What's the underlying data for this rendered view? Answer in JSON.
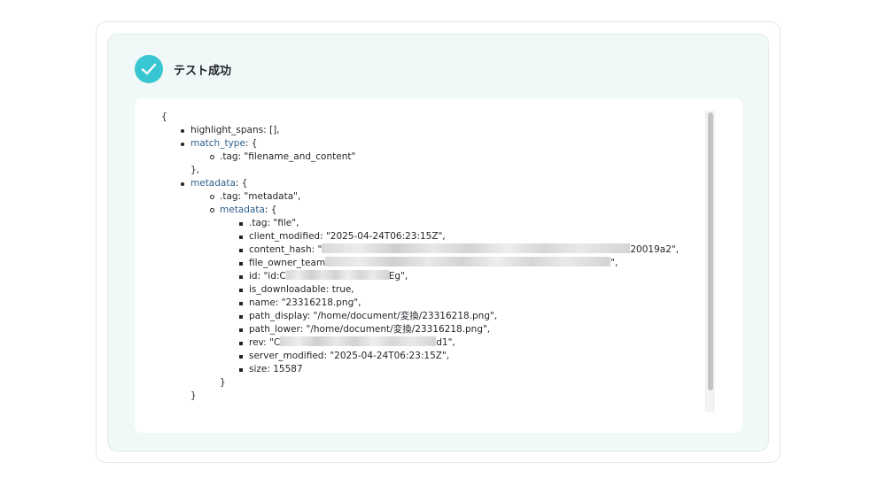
{
  "header": {
    "title": "テスト成功",
    "icon": "check-circle-icon",
    "accent_color": "#38c7d2"
  },
  "json": {
    "open_brace": "{",
    "highlight_spans": "highlight_spans: [],",
    "match_type_key": "match_type",
    "match_type_open": ": {",
    "match_type_tag": ".tag: \"filename_and_content\"",
    "match_type_close": "},",
    "metadata_key": "metadata",
    "metadata_open": ": {",
    "metadata_tag": ".tag: \"metadata\",",
    "inner_metadata_key": "metadata",
    "inner_metadata_open": ": {",
    "fields": {
      "tag": ".tag: \"file\",",
      "client_modified": "client_modified: \"2025-04-24T06:23:15Z\",",
      "content_hash_prefix": "content_hash: \"",
      "content_hash_suffix": "20019a2\",",
      "file_owner_team_prefix": "file_owner_team",
      "file_owner_team_suffix": "\",",
      "id_prefix": "id: \"id:C",
      "id_suffix": "Eg\",",
      "is_downloadable": "is_downloadable: true,",
      "name": "name: \"23316218.png\",",
      "path_display": "path_display: \"/home/document/変換/23316218.png\",",
      "path_lower": "path_lower: \"/home/document/変換/23316218.png\",",
      "rev_prefix": "rev: \"C",
      "rev_suffix": "d1\",",
      "server_modified": "server_modified: \"2025-04-24T06:23:15Z\",",
      "size": "size: 15587"
    },
    "inner_close": "}",
    "metadata_close": "}"
  },
  "colors": {
    "link": "#2f5f8a",
    "panel_bg": "#f1f8f8"
  }
}
